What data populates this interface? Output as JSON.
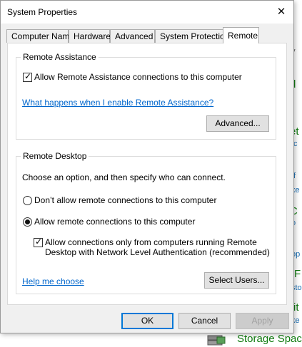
{
  "background": {
    "fragments": [
      {
        "text": "y",
        "style": "gray"
      },
      {
        "text": "d",
        "style": "green"
      },
      {
        "text": "r",
        "style": "blue"
      },
      {
        "text": "et",
        "style": "green"
      },
      {
        "text": "tc",
        "style": "blue"
      },
      {
        "text": "If",
        "style": "blue"
      },
      {
        "text": "ke",
        "style": "blue"
      },
      {
        "text": "C",
        "style": "green"
      },
      {
        "text": "o",
        "style": "blue"
      },
      {
        "text": "op",
        "style": "blue"
      },
      {
        "text": "F",
        "style": "green"
      },
      {
        "text": "sto",
        "style": "blue"
      },
      {
        "text": "rit",
        "style": "green"
      },
      {
        "text": "ke",
        "style": "blue"
      }
    ],
    "storage_label": "Storage Spac"
  },
  "dialog": {
    "title": "System Properties",
    "close_glyph": "✕",
    "tabs": [
      "Computer Name",
      "Hardware",
      "Advanced",
      "System Protection",
      "Remote"
    ],
    "active_tab": "Remote"
  },
  "remote_assistance": {
    "group_label": "Remote Assistance",
    "allow_label": "Allow Remote Assistance connections to this computer",
    "allow_checked": true,
    "help_link": "What happens when I enable Remote Assistance?",
    "advanced_button": "Advanced..."
  },
  "remote_desktop": {
    "group_label": "Remote Desktop",
    "instruction": "Choose an option, and then specify who can connect.",
    "option_dont_allow": "Don’t allow remote connections to this computer",
    "option_allow": "Allow remote connections to this computer",
    "selected_option": "allow",
    "nla_label_line1": "Allow connections only from computers running Remote",
    "nla_label_line2": "Desktop with Network Level Authentication (recommended)",
    "nla_checked": true,
    "help_link": "Help me choose",
    "select_users_button": "Select Users..."
  },
  "footer": {
    "ok": "OK",
    "cancel": "Cancel",
    "apply": "Apply"
  }
}
